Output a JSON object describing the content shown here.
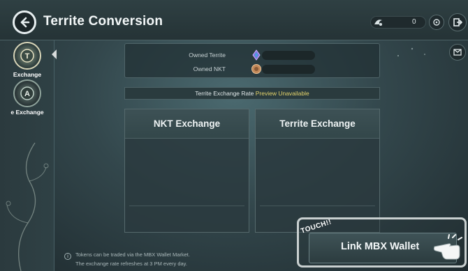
{
  "header": {
    "title": "Territe Conversion",
    "token_count": "0"
  },
  "sidebar": {
    "items": [
      {
        "label": "Exchange",
        "badge": "T",
        "active": true
      },
      {
        "label": "e Exchange",
        "badge": "A",
        "active": false
      }
    ]
  },
  "owned": {
    "territe_label": "Owned Territe",
    "nkt_label": "Owned NKT"
  },
  "rate": {
    "label": "Territe Exchange Rate",
    "status": "Preview Unavailable"
  },
  "panels": {
    "nkt_title": "NKT Exchange",
    "territe_title": "Territe Exchange"
  },
  "notes": {
    "line1": "Tokens can be traded via the MBX Wallet Market.",
    "line2": "The exchange rate refreshes at 3 PM every day."
  },
  "link_wallet": {
    "label": "Link MBX Wallet",
    "touch": "TOUCH!!"
  },
  "colors": {
    "accent_yellow": "#e4d36b",
    "territe_gem": "#8a6de0",
    "nkt_coin": "#c48a5a"
  }
}
